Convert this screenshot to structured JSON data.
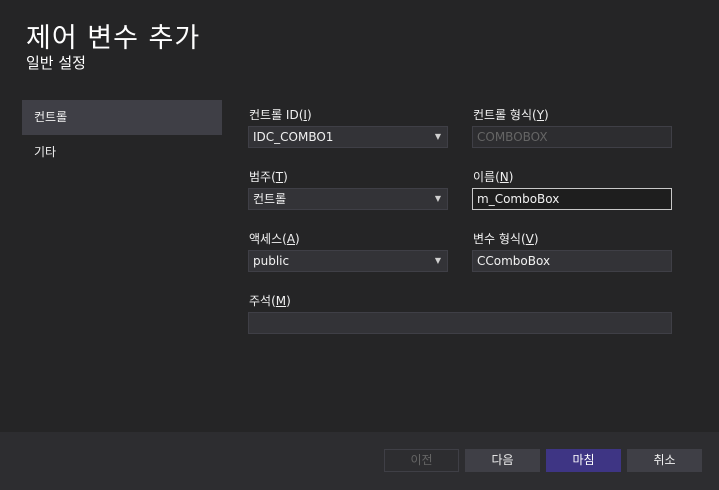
{
  "header": {
    "title": "제어 변수 추가",
    "subtitle": "일반 설정"
  },
  "sidebar": {
    "items": [
      {
        "label": "컨트롤",
        "selected": true
      },
      {
        "label": "기타",
        "selected": false
      }
    ]
  },
  "form": {
    "control_id": {
      "label": "컨트롤 ID",
      "accel": "I",
      "value": "IDC_COMBO1"
    },
    "control_type": {
      "label": "컨트롤 형식",
      "accel": "Y",
      "value": "COMBOBOX"
    },
    "category": {
      "label": "범주",
      "accel": "T",
      "value": "컨트롤"
    },
    "name": {
      "label": "이름",
      "accel": "N",
      "value": "m_ComboBox"
    },
    "access": {
      "label": "액세스",
      "accel": "A",
      "value": "public"
    },
    "variable_type": {
      "label": "변수 형식",
      "accel": "V",
      "value": "CComboBox"
    },
    "comment": {
      "label": "주석",
      "accel": "M",
      "value": ""
    }
  },
  "footer": {
    "prev_label": "이전",
    "next_label": "다음",
    "finish_label": "마침",
    "cancel_label": "취소"
  },
  "colors": {
    "background": "#252526",
    "selected_nav": "#3f3f46",
    "primary_button": "#3e3584"
  }
}
